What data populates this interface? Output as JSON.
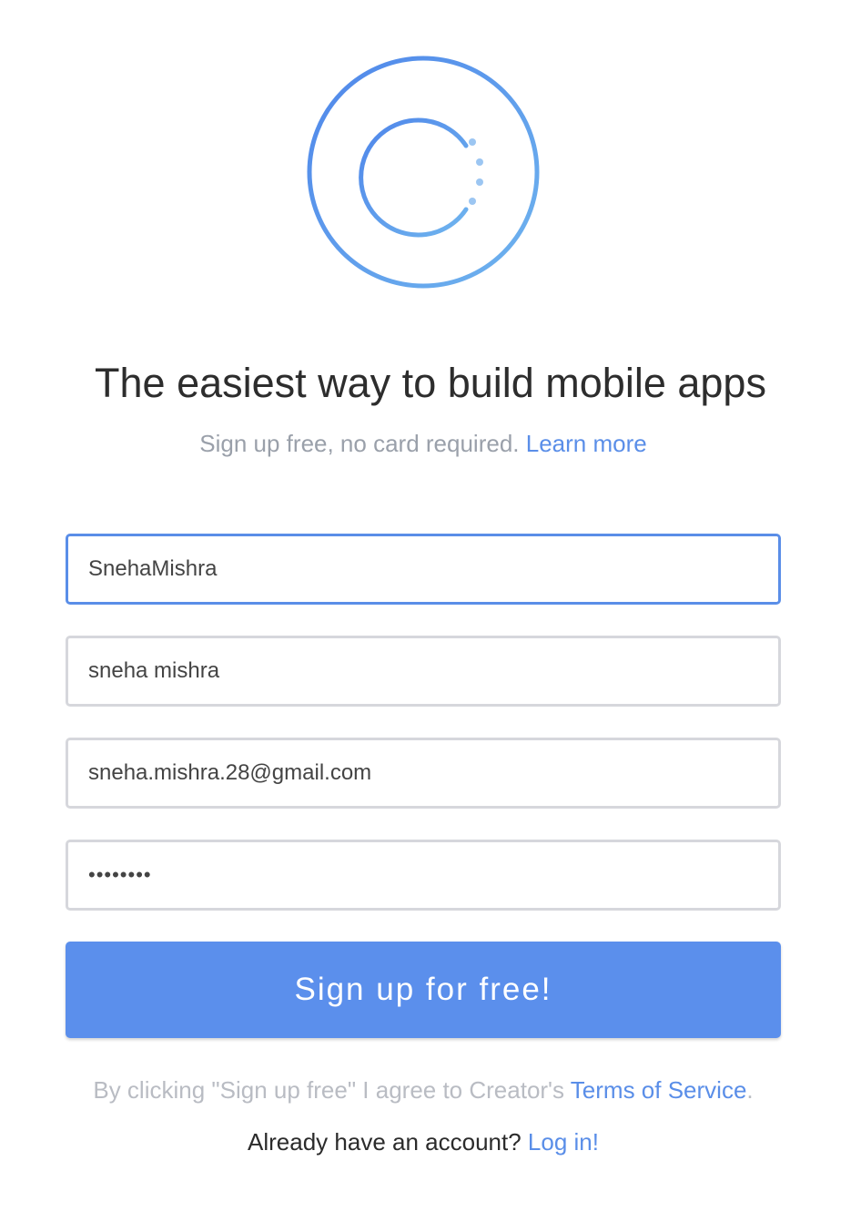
{
  "brand": {
    "logo_icon": "creator-logo-icon",
    "accent_color": "#5b8fec",
    "link_color": "#5a8ee8"
  },
  "headline": "The easiest way to build mobile apps",
  "subheading": {
    "text": "Sign up free, no card required.",
    "link": "Learn more"
  },
  "form": {
    "username": "SnehaMishra",
    "full_name": "sneha mishra",
    "email": "sneha.mishra.28@gmail.com",
    "password_masked": "••••••••"
  },
  "submit_label": "Sign up for free!",
  "terms": {
    "prefix": "By clicking \"Sign up free\" I agree to Creator's",
    "link": "Terms of Service",
    "suffix": "."
  },
  "login": {
    "prompt": "Already have an account?",
    "link": "Log in!"
  }
}
